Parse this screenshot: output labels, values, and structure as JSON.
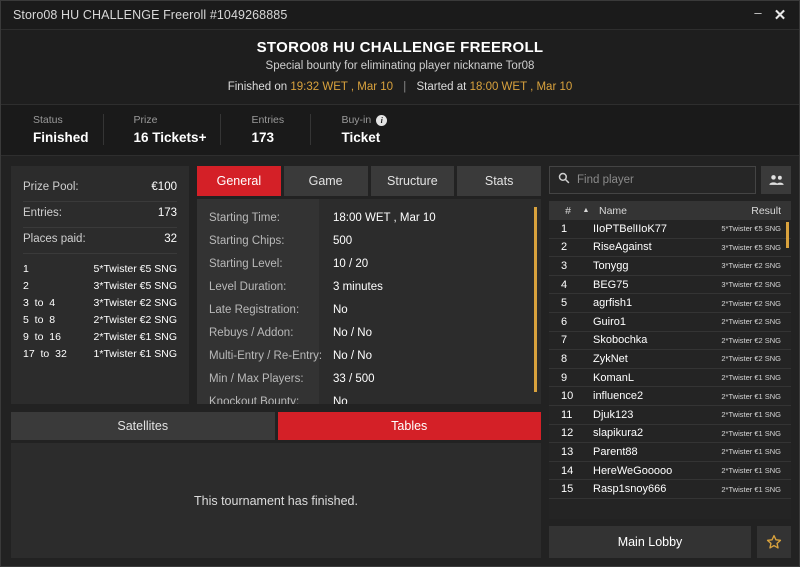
{
  "window": {
    "title": "Storo08 HU CHALLENGE Freeroll #1049268885",
    "minimize_label": "–",
    "close_label": "✕"
  },
  "header": {
    "title": "STORO08 HU CHALLENGE FREEROLL",
    "subtitle": "Special bounty for eliminating player nickname Tor08",
    "finished_prefix": "Finished on",
    "finished_time": "19:32 WET , Mar 10",
    "separator": "|",
    "started_prefix": "Started at",
    "started_time": "18:00 WET , Mar 10",
    "accent_gold": "#d9a23d"
  },
  "status": {
    "items": [
      {
        "label": "Status",
        "value": "Finished",
        "info": false
      },
      {
        "label": "Prize",
        "value": "16 Tickets+",
        "info": false
      },
      {
        "label": "Entries",
        "value": "173",
        "info": false
      },
      {
        "label": "Buy-in",
        "value": "Ticket",
        "info": true,
        "info_glyph": "i"
      }
    ]
  },
  "prize_panel": {
    "rows": [
      {
        "label": "Prize Pool:",
        "value": "€100"
      },
      {
        "label": "Entries:",
        "value": "173"
      },
      {
        "label": "Places paid:",
        "value": "32"
      }
    ],
    "payouts": [
      {
        "place": "1",
        "prize": "5*Twister €5 SNG"
      },
      {
        "place": "2",
        "prize": "3*Twister €5 SNG"
      },
      {
        "place": "3  to  4",
        "prize": "3*Twister €2 SNG"
      },
      {
        "place": "5  to  8",
        "prize": "2*Twister €2 SNG"
      },
      {
        "place": "9  to  16",
        "prize": "2*Twister €1 SNG"
      },
      {
        "place": "17  to  32",
        "prize": "1*Twister €1 SNG"
      }
    ]
  },
  "tabs": {
    "items": [
      {
        "label": "General",
        "active": true
      },
      {
        "label": "Game",
        "active": false
      },
      {
        "label": "Structure",
        "active": false
      },
      {
        "label": "Stats",
        "active": false
      }
    ]
  },
  "general_info": {
    "rows": [
      {
        "label": "Starting Time:",
        "value": "18:00 WET , Mar 10"
      },
      {
        "label": "Starting Chips:",
        "value": "500"
      },
      {
        "label": "Starting Level:",
        "value": "10 / 20"
      },
      {
        "label": "Level Duration:",
        "value": "3 minutes"
      },
      {
        "label": "Late Registration:",
        "value": "No"
      },
      {
        "label": "Rebuys / Addon:",
        "value": "No / No"
      },
      {
        "label": "Multi-Entry / Re-Entry:",
        "value": "No / No"
      },
      {
        "label": "Min / Max Players:",
        "value": "33 / 500"
      },
      {
        "label": "Knockout Bounty:",
        "value": "No"
      }
    ]
  },
  "lower_tabs": {
    "items": [
      {
        "label": "Satellites",
        "active": false
      },
      {
        "label": "Tables",
        "active": true
      }
    ],
    "empty_message": "This tournament has finished."
  },
  "search": {
    "placeholder": "Find player",
    "value": "",
    "search_icon": "search-icon",
    "players_icon": "people-icon"
  },
  "player_list": {
    "columns": {
      "num": "#",
      "sort": "▲",
      "name": "Name",
      "result": "Result"
    },
    "rows": [
      {
        "num": "1",
        "name": "IIoPTBelIIoK77",
        "result": "5*Twister €5 SNG"
      },
      {
        "num": "2",
        "name": "RiseAgainst",
        "result": "3*Twister €5 SNG"
      },
      {
        "num": "3",
        "name": "Tonygg",
        "result": "3*Twister €2 SNG"
      },
      {
        "num": "4",
        "name": "BEG75",
        "result": "3*Twister €2 SNG"
      },
      {
        "num": "5",
        "name": "agrfish1",
        "result": "2*Twister €2 SNG"
      },
      {
        "num": "6",
        "name": "Guiro1",
        "result": "2*Twister €2 SNG"
      },
      {
        "num": "7",
        "name": "Skobochka",
        "result": "2*Twister €2 SNG"
      },
      {
        "num": "8",
        "name": "ZykNet",
        "result": "2*Twister €2 SNG"
      },
      {
        "num": "9",
        "name": "KomanL",
        "result": "2*Twister €1 SNG"
      },
      {
        "num": "10",
        "name": "influence2",
        "result": "2*Twister €1 SNG"
      },
      {
        "num": "11",
        "name": "Djuk123",
        "result": "2*Twister €1 SNG"
      },
      {
        "num": "12",
        "name": "slapikura2",
        "result": "2*Twister €1 SNG"
      },
      {
        "num": "13",
        "name": "Parent88",
        "result": "2*Twister €1 SNG"
      },
      {
        "num": "14",
        "name": "HereWeGooooo",
        "result": "2*Twister €1 SNG"
      },
      {
        "num": "15",
        "name": "Rasp1snoy666",
        "result": "2*Twister €1 SNG"
      }
    ]
  },
  "footer": {
    "main_lobby_label": "Main Lobby",
    "favorite_icon": "star-icon"
  },
  "colors": {
    "accent_red": "#d42027",
    "accent_gold": "#d9a23d",
    "panel_bg": "#2c2c2c",
    "window_bg": "#222222"
  }
}
